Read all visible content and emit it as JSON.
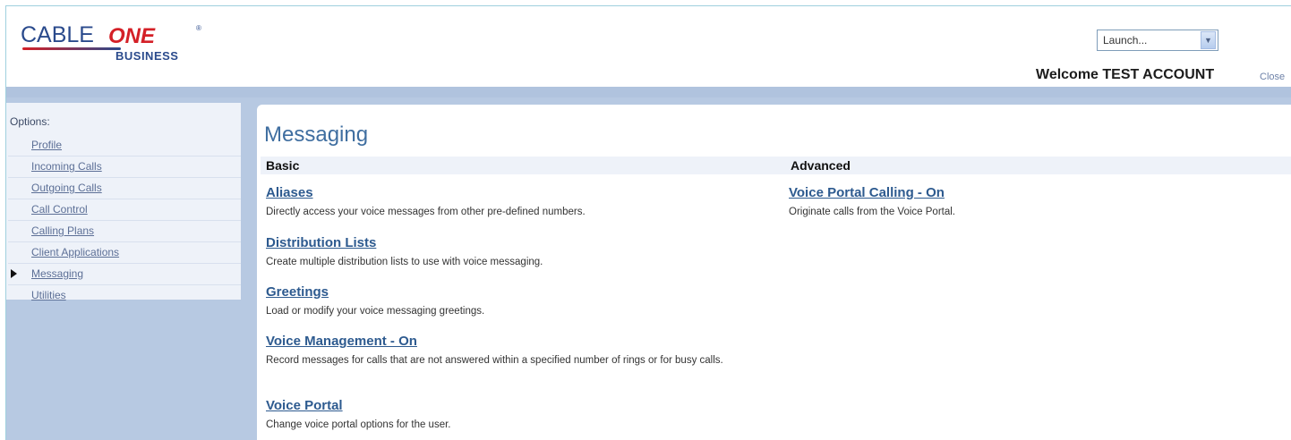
{
  "header": {
    "logo": {
      "cable": "CABLE",
      "one": "ONE",
      "business": "BUSINESS",
      "tm": "®"
    },
    "launch": {
      "selected": "Launch...",
      "dropdown_icon": "chevron-down-icon"
    },
    "welcome": "Welcome TEST ACCOUNT",
    "close_link": "Close"
  },
  "sidebar": {
    "options_label": "Options:",
    "items": [
      {
        "label": "Profile",
        "active": false
      },
      {
        "label": "Incoming Calls",
        "active": false
      },
      {
        "label": "Outgoing Calls",
        "active": false
      },
      {
        "label": "Call Control",
        "active": false
      },
      {
        "label": "Calling Plans",
        "active": false
      },
      {
        "label": "Client Applications",
        "active": false
      },
      {
        "label": "Messaging",
        "active": true
      },
      {
        "label": "Utilities",
        "active": false
      }
    ]
  },
  "main": {
    "title": "Messaging",
    "basic": {
      "heading": "Basic",
      "items": [
        {
          "link": "Aliases",
          "desc": "Directly access your voice messages from other pre-defined numbers."
        },
        {
          "link": "Distribution Lists",
          "desc": "Create multiple distribution lists to use with voice messaging."
        },
        {
          "link": "Greetings",
          "desc": "Load or modify your voice messaging greetings."
        },
        {
          "link": "Voice Management - On",
          "desc": "Record messages for calls that are not answered within a specified number of rings or for busy calls."
        },
        {
          "link": "Voice Portal",
          "desc": "Change voice portal options for the user."
        }
      ]
    },
    "advanced": {
      "heading": "Advanced",
      "items": [
        {
          "link": "Voice Portal Calling - On",
          "desc": "Originate calls from the Voice Portal."
        }
      ]
    }
  },
  "colors": {
    "brand_blue": "#2a4a8c",
    "brand_red": "#d42027",
    "link": "#2d5a8f",
    "sidebar_bg": "#b7c9e2",
    "title": "#3f6ea0"
  }
}
